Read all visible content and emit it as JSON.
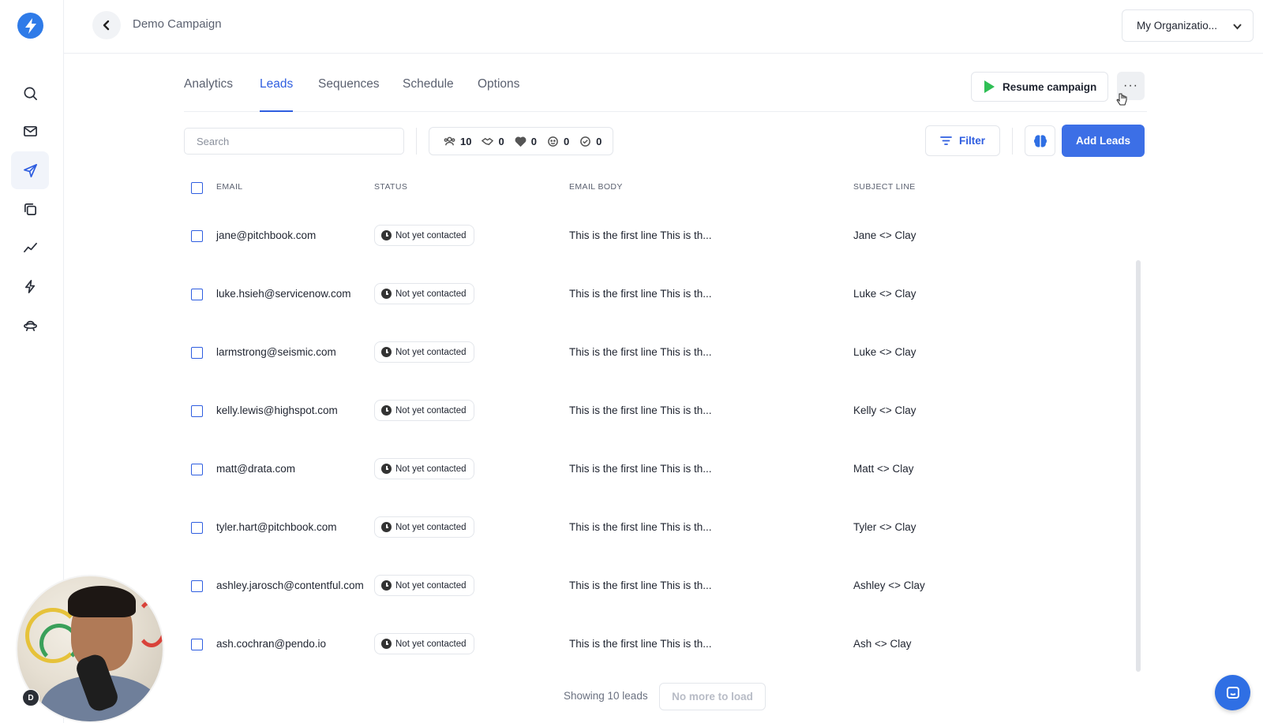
{
  "header": {
    "title": "Demo Campaign",
    "org_selector": "My Organizatio..."
  },
  "sidebar": {
    "items": [
      {
        "name": "search-icon"
      },
      {
        "name": "mail-icon"
      },
      {
        "name": "send-icon",
        "active": true
      },
      {
        "name": "copy-icon"
      },
      {
        "name": "analytics-icon"
      },
      {
        "name": "bolt-icon"
      },
      {
        "name": "ufo-icon"
      }
    ]
  },
  "tabs": [
    {
      "label": "Analytics",
      "active": false
    },
    {
      "label": "Leads",
      "active": true
    },
    {
      "label": "Sequences",
      "active": false
    },
    {
      "label": "Schedule",
      "active": false
    },
    {
      "label": "Options",
      "active": false
    }
  ],
  "actions": {
    "resume_label": "Resume campaign",
    "more_label": "···"
  },
  "toolbar": {
    "search_placeholder": "Search",
    "stats": [
      {
        "icon": "users-icon",
        "value": "10"
      },
      {
        "icon": "handshake-icon",
        "value": "0"
      },
      {
        "icon": "heart-icon",
        "value": "0"
      },
      {
        "icon": "smile-icon",
        "value": "0"
      },
      {
        "icon": "check-circle-icon",
        "value": "0"
      }
    ],
    "filter_label": "Filter",
    "add_leads_label": "Add Leads"
  },
  "table": {
    "headers": {
      "email": "EMAIL",
      "status": "STATUS",
      "email_body": "EMAIL BODY",
      "subject_line": "SUBJECT LINE"
    },
    "rows": [
      {
        "email": "jane@pitchbook.com",
        "status": "Not yet contacted",
        "body": "This is the first line This is th...",
        "subject": "Jane <> Clay"
      },
      {
        "email": "luke.hsieh@servicenow.com",
        "status": "Not yet contacted",
        "body": "This is the first line This is th...",
        "subject": "Luke <> Clay"
      },
      {
        "email": "larmstrong@seismic.com",
        "status": "Not yet contacted",
        "body": "This is the first line This is th...",
        "subject": "Luke <> Clay"
      },
      {
        "email": "kelly.lewis@highspot.com",
        "status": "Not yet contacted",
        "body": "This is the first line This is th...",
        "subject": "Kelly <> Clay"
      },
      {
        "email": "matt@drata.com",
        "status": "Not yet contacted",
        "body": "This is the first line This is th...",
        "subject": "Matt <> Clay"
      },
      {
        "email": "tyler.hart@pitchbook.com",
        "status": "Not yet contacted",
        "body": "This is the first line This is th...",
        "subject": "Tyler <> Clay"
      },
      {
        "email": "ashley.jarosch@contentful.com",
        "status": "Not yet contacted",
        "body": "This is the first line This is th...",
        "subject": "Ashley <> Clay"
      },
      {
        "email": "ash.cochran@pendo.io",
        "status": "Not yet contacted",
        "body": "This is the first line This is th...",
        "subject": "Ash <> Clay"
      }
    ]
  },
  "footer": {
    "showing_text": "Showing 10 leads",
    "load_more_label": "No more to load"
  },
  "webcam": {
    "avatar_initial": "D"
  },
  "colors": {
    "accent": "#2f5ee0",
    "primary_button": "#3c6fe6",
    "play_green": "#2fbf55"
  }
}
